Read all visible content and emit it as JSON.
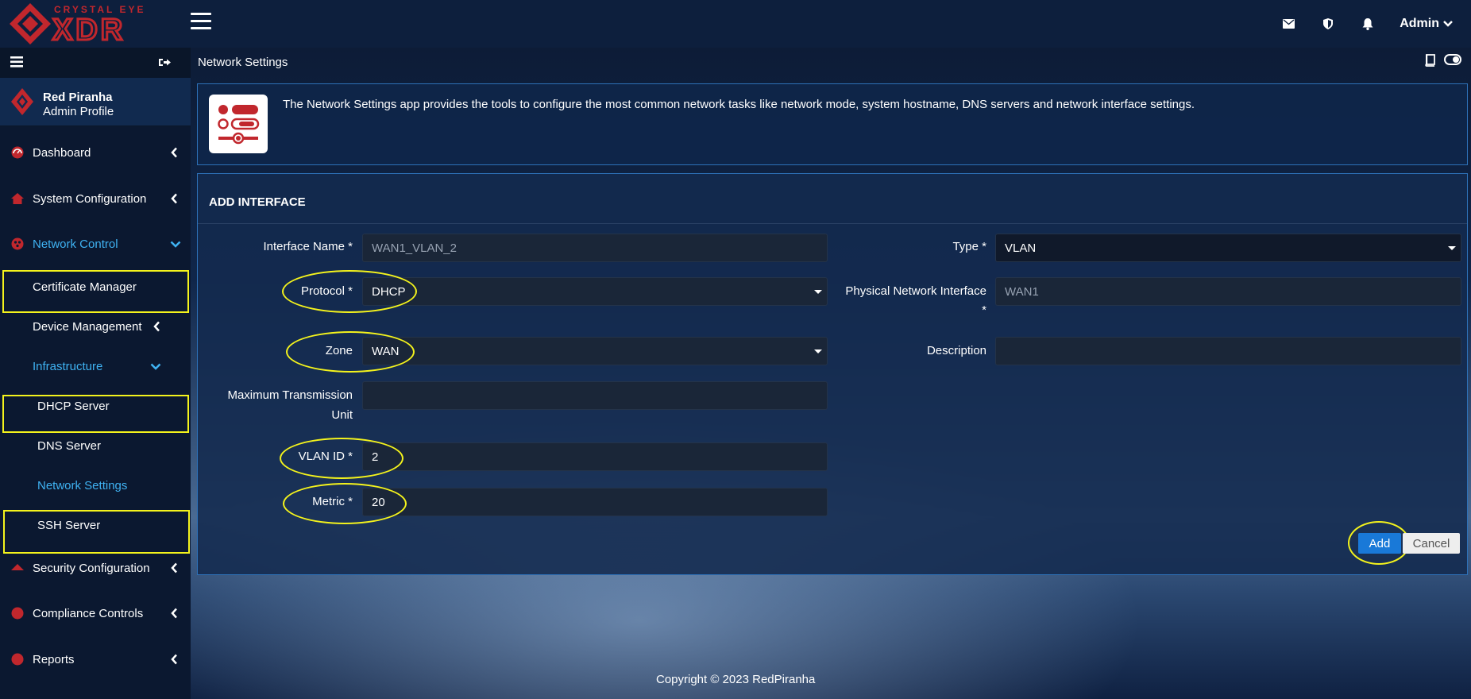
{
  "header": {
    "brand_top": "CRYSTAL EYE",
    "brand_main": "XDR",
    "user_label": "Admin",
    "icons": [
      "envelope-icon",
      "shield-icon",
      "bell-icon",
      "chevron-down-icon"
    ]
  },
  "sidebar": {
    "profile_name": "Red Piranha",
    "profile_sub": "Admin Profile",
    "items": [
      {
        "label": "Dashboard"
      },
      {
        "label": "System Configuration"
      },
      {
        "label": "Network Control"
      },
      {
        "label": "Certificate Manager"
      },
      {
        "label": "Device Management"
      },
      {
        "label": "Infrastructure"
      },
      {
        "label": "DHCP Server"
      },
      {
        "label": "DNS Server"
      },
      {
        "label": "Network Settings"
      },
      {
        "label": "SSH Server"
      },
      {
        "label": "Security Configuration"
      },
      {
        "label": "Compliance Controls"
      },
      {
        "label": "Reports"
      }
    ],
    "colors": {
      "active": "#3fb2f2",
      "highlight": "#f4f31c"
    }
  },
  "page": {
    "title": "Network Settings",
    "description": "The Network Settings app provides the tools to configure the most common network tasks like network mode, system hostname, DNS servers and network interface settings."
  },
  "form": {
    "heading": "ADD INTERFACE",
    "interface_name": {
      "label": "Interface Name *",
      "placeholder": "WAN1_VLAN_2"
    },
    "type": {
      "label": "Type *",
      "value": "VLAN"
    },
    "protocol": {
      "label": "Protocol *",
      "value": "DHCP"
    },
    "physical": {
      "label_line1": "Physical Network Interface",
      "label_line2": "*",
      "placeholder": "WAN1"
    },
    "zone": {
      "label": "Zone",
      "value": "WAN"
    },
    "description": {
      "label": "Description",
      "value": ""
    },
    "mtu": {
      "label_line1": "Maximum Transmission",
      "label_line2": "Unit",
      "value": ""
    },
    "vlan_id": {
      "label": "VLAN ID *",
      "value": "2"
    },
    "metric": {
      "label": "Metric *",
      "value": "20"
    },
    "add_label": "Add",
    "cancel_label": "Cancel"
  },
  "footer": {
    "text": "Copyright © 2023 RedPiranha"
  }
}
